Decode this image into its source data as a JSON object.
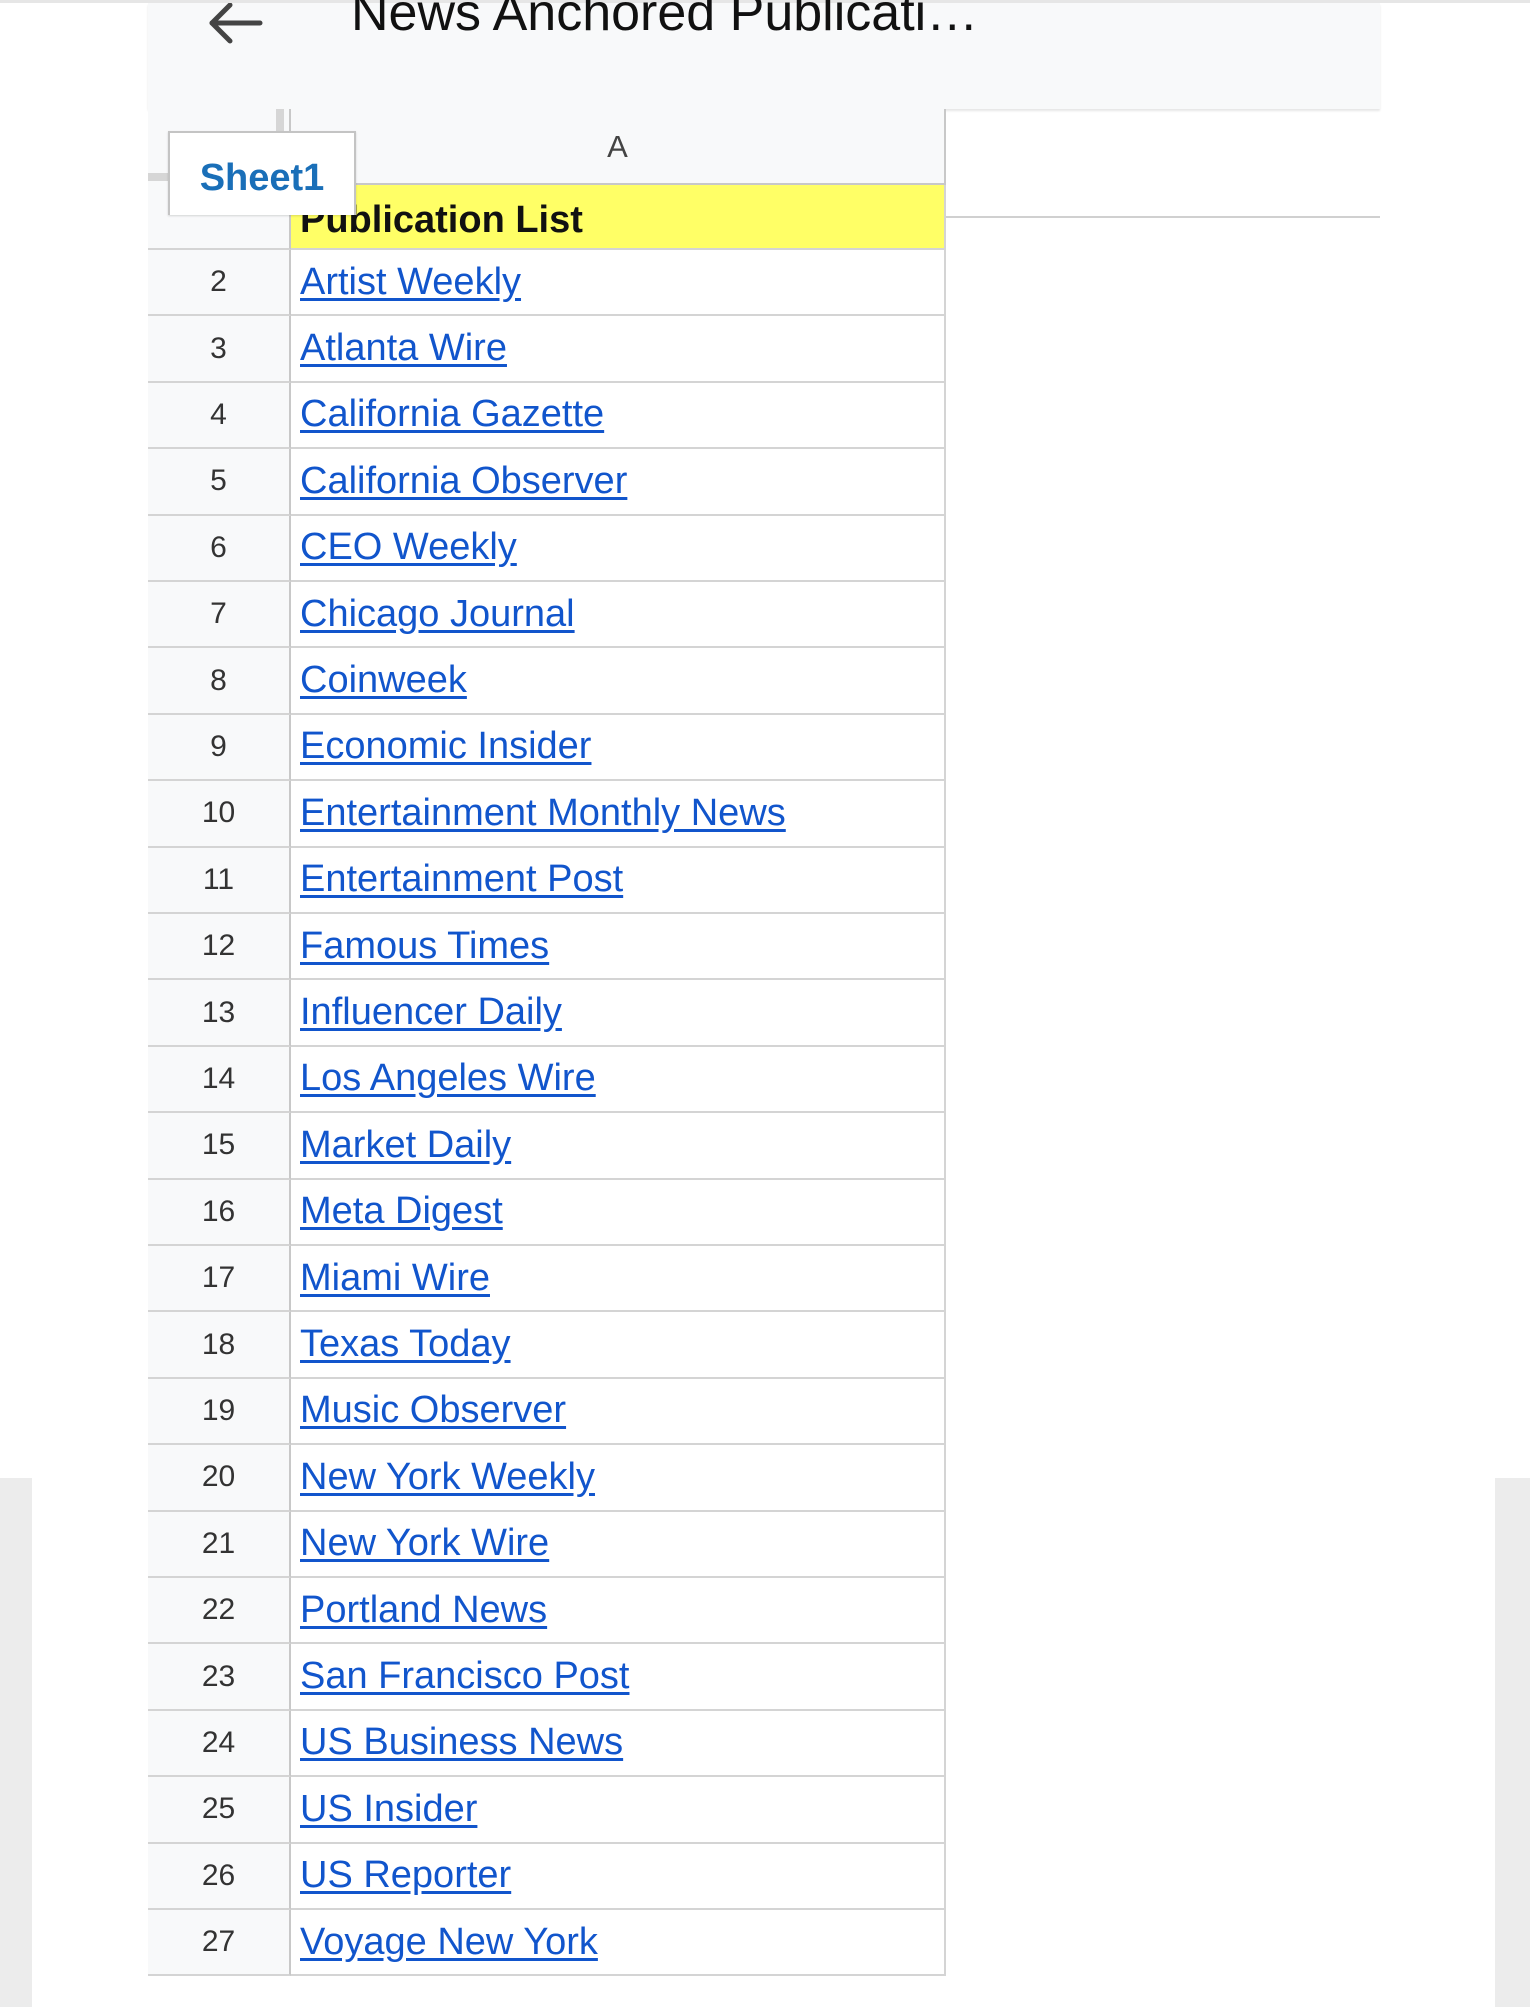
{
  "app": {
    "title": "News Anchored Publicati…",
    "sheet_tab": "Sheet1"
  },
  "grid": {
    "column_header": "A",
    "header_row": {
      "row_number": "1",
      "value": "Publication List",
      "highlight_color": "#ffff66"
    },
    "rows": [
      {
        "n": "2",
        "value": "Artist Weekly"
      },
      {
        "n": "3",
        "value": "Atlanta Wire"
      },
      {
        "n": "4",
        "value": "California Gazette"
      },
      {
        "n": "5",
        "value": "California Observer"
      },
      {
        "n": "6",
        "value": "CEO Weekly"
      },
      {
        "n": "7",
        "value": "Chicago Journal"
      },
      {
        "n": "8",
        "value": "Coinweek"
      },
      {
        "n": "9",
        "value": "Economic Insider"
      },
      {
        "n": "10",
        "value": "Entertainment Monthly News"
      },
      {
        "n": "11",
        "value": "Entertainment Post"
      },
      {
        "n": "12",
        "value": "Famous Times"
      },
      {
        "n": "13",
        "value": "Influencer Daily"
      },
      {
        "n": "14",
        "value": "Los Angeles Wire"
      },
      {
        "n": "15",
        "value": "Market Daily"
      },
      {
        "n": "16",
        "value": "Meta Digest"
      },
      {
        "n": "17",
        "value": "Miami Wire"
      },
      {
        "n": "18",
        "value": "Texas Today"
      },
      {
        "n": "19",
        "value": "Music Observer"
      },
      {
        "n": "20",
        "value": "New York Weekly"
      },
      {
        "n": "21",
        "value": "New York Wire"
      },
      {
        "n": "22",
        "value": "Portland News"
      },
      {
        "n": "23",
        "value": "San Francisco Post"
      },
      {
        "n": "24",
        "value": "US Business News"
      },
      {
        "n": "25",
        "value": "US Insider"
      },
      {
        "n": "26",
        "value": "US Reporter"
      },
      {
        "n": "27",
        "value": "Voyage New York"
      }
    ]
  },
  "icons": {
    "back": "back-arrow-icon"
  },
  "colors": {
    "link": "#1155cc",
    "sheet_tab_text": "#1a6fb8"
  }
}
